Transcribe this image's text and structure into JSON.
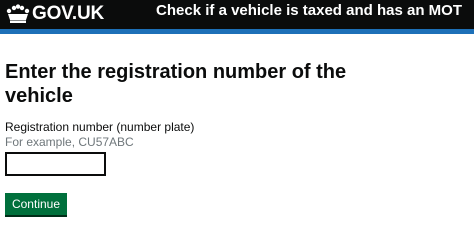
{
  "header": {
    "logo_text": "GOV.UK",
    "logo_icon": "crown-icon",
    "service_name": "Check if a vehicle is taxed and has an MOT"
  },
  "main": {
    "heading": "Enter the registration number of the vehicle",
    "field": {
      "label": "Registration number (number plate)",
      "hint": "For example, CU57ABC",
      "value": "",
      "placeholder": ""
    },
    "continue_label": "Continue"
  },
  "colors": {
    "header_bg": "#0b0c0c",
    "accent_bar": "#1d70b8",
    "button_green": "#00703c",
    "hint_grey": "#6f777b"
  }
}
